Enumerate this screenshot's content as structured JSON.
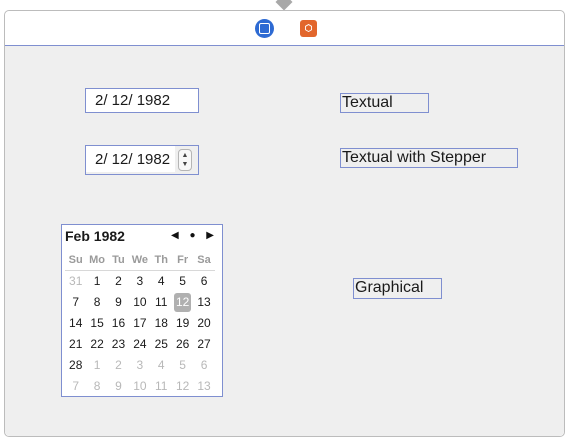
{
  "toolbar": {
    "icons": [
      "view-controller-icon",
      "object-cube-icon"
    ],
    "cube_glyph": "⬡"
  },
  "pickers": {
    "textual_value": "2/ 12/ 1982",
    "stepper_value": "2/ 12/ 1982",
    "stepper_up": "▲",
    "stepper_down": "▼"
  },
  "labels": {
    "textual": "Textual",
    "textual_with_stepper": "Textual with Stepper",
    "graphical": "Graphical"
  },
  "calendar": {
    "month_label": "Feb 1982",
    "nav": "◀ ● ▶",
    "weekdays": [
      "Su",
      "Mo",
      "Tu",
      "We",
      "Th",
      "Fr",
      "Sa"
    ],
    "days": [
      {
        "d": "31",
        "muted": true
      },
      {
        "d": "1"
      },
      {
        "d": "2"
      },
      {
        "d": "3"
      },
      {
        "d": "4"
      },
      {
        "d": "5"
      },
      {
        "d": "6"
      },
      {
        "d": "7"
      },
      {
        "d": "8"
      },
      {
        "d": "9"
      },
      {
        "d": "10"
      },
      {
        "d": "11"
      },
      {
        "d": "12",
        "selected": true
      },
      {
        "d": "13"
      },
      {
        "d": "14"
      },
      {
        "d": "15"
      },
      {
        "d": "16"
      },
      {
        "d": "17"
      },
      {
        "d": "18"
      },
      {
        "d": "19"
      },
      {
        "d": "20"
      },
      {
        "d": "21"
      },
      {
        "d": "22"
      },
      {
        "d": "23"
      },
      {
        "d": "24"
      },
      {
        "d": "25"
      },
      {
        "d": "26"
      },
      {
        "d": "27"
      },
      {
        "d": "28"
      },
      {
        "d": "1",
        "muted": true
      },
      {
        "d": "2",
        "muted": true
      },
      {
        "d": "3",
        "muted": true
      },
      {
        "d": "4",
        "muted": true
      },
      {
        "d": "5",
        "muted": true
      },
      {
        "d": "6",
        "muted": true
      },
      {
        "d": "7",
        "muted": true
      },
      {
        "d": "8",
        "muted": true
      },
      {
        "d": "9",
        "muted": true
      },
      {
        "d": "10",
        "muted": true
      },
      {
        "d": "11",
        "muted": true
      },
      {
        "d": "12",
        "muted": true
      },
      {
        "d": "13",
        "muted": true
      }
    ],
    "selected_color": "#b0b0b0"
  },
  "colors": {
    "selection_outline": "#7f8fd0",
    "accent_blue": "#2d6ad3",
    "accent_orange": "#e2662c"
  }
}
